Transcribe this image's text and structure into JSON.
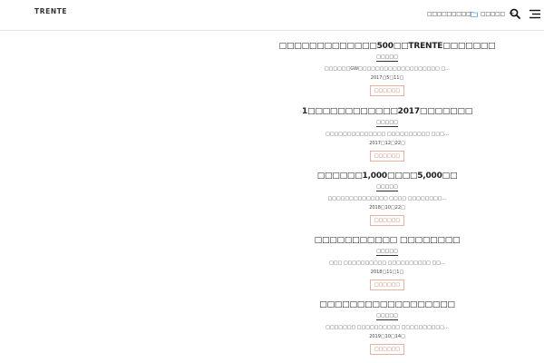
{
  "header": {
    "logo": "TRENTE",
    "nav_link": "□□□□□□□□□",
    "category_label": "□□□□□",
    "plus": "+"
  },
  "icons": {
    "folder": "folder-icon",
    "search": "search-icon",
    "menu": "menu-icon"
  },
  "colors": {
    "accent": "#b5634a",
    "accent_border": "#e3b4a4",
    "folder_icon": "#4a90d9"
  },
  "posts": [
    {
      "title": "□□□□□□□□□□□□□500□□TRENTE□□□□□□□",
      "author": "□□□□□",
      "excerpt": "□□□□□□GW□□□□□□□□□□□□□□□□□□□ □…",
      "date": "2017□5□11□",
      "more": "□□□□□□"
    },
    {
      "title": "1□□□□□□□□□□□□2017□□□□□□□",
      "author": "□□□□□",
      "excerpt": "□□□□□□□□□□□□□□ □□□□□□□□□□ □□□…",
      "date": "2017□12□22□",
      "more": "□□□□□□"
    },
    {
      "title": "□□□□□□1,000□□□□5,000□□",
      "author": "□□□□□",
      "excerpt": "□□□□□□□□□□□□□□ □□□□ □□□□□□□□…",
      "date": "2018□10□22□",
      "more": "□□□□□□"
    },
    {
      "title": "□□□□□□□□□□□ □□□□□□□□",
      "author": "□□□□□",
      "excerpt": "□□□ □□□□□□□□□□ □□□□□□□□□□ □□…",
      "date": "2018□11□1□",
      "more": "□□□□□□"
    },
    {
      "title": "□□□□□□□□□□□□□□□□□□",
      "author": "□□□□□",
      "excerpt": "□□□□□□□ □□□□□□□□□□ □□□□□□□□□□…",
      "date": "2019□10□14□",
      "more": "□□□□□□"
    }
  ]
}
